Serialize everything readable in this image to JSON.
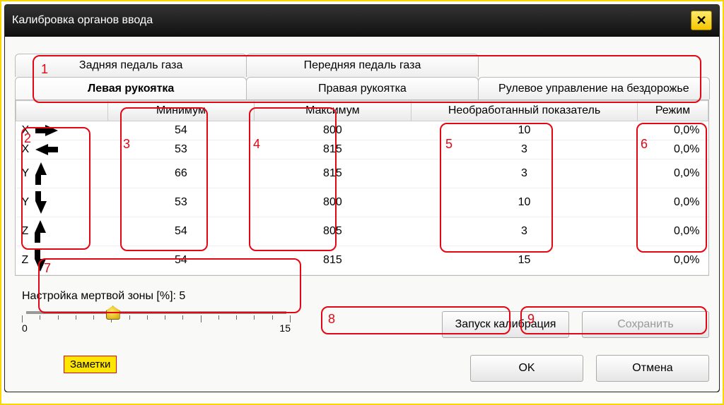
{
  "window": {
    "title": "Калибровка органов ввода"
  },
  "tabs_row1": [
    {
      "label": "Задняя педаль газа"
    },
    {
      "label": "Передняя педаль газа"
    },
    {
      "label": ""
    }
  ],
  "tabs_row2": [
    {
      "label": "Левая рукоятка",
      "active": true
    },
    {
      "label": "Правая рукоятка"
    },
    {
      "label": "Рулевое управление на бездорожье"
    }
  ],
  "columns": {
    "axis": "",
    "min": "Минимум",
    "max": "Максимум",
    "raw": "Необработанный показатель",
    "mode": "Режим"
  },
  "rows": [
    {
      "axis": "X",
      "dir": "right",
      "min": "54",
      "max": "800",
      "raw": "10",
      "mode": "0,0%"
    },
    {
      "axis": "X",
      "dir": "left",
      "min": "53",
      "max": "815",
      "raw": "3",
      "mode": "0,0%"
    },
    {
      "axis": "Y",
      "dir": "up",
      "min": "66",
      "max": "815",
      "raw": "3",
      "mode": "0,0%"
    },
    {
      "axis": "Y",
      "dir": "down",
      "min": "53",
      "max": "800",
      "raw": "10",
      "mode": "0,0%"
    },
    {
      "axis": "Z",
      "dir": "up",
      "min": "54",
      "max": "805",
      "raw": "3",
      "mode": "0,0%"
    },
    {
      "axis": "Z",
      "dir": "down",
      "min": "54",
      "max": "815",
      "raw": "15",
      "mode": "0,0%"
    }
  ],
  "deadzone": {
    "label": "Настройка мертвой зоны [%]: 5",
    "value": 5,
    "min": 0,
    "max": 15,
    "min_label": "0",
    "max_label": "15"
  },
  "buttons": {
    "start": "Запуск калибрация",
    "save": "Сохранить",
    "ok": "OK",
    "cancel": "Отмена"
  },
  "notes_badge": "Заметки",
  "annotations": {
    "1": "1",
    "2": "2",
    "3": "3",
    "4": "4",
    "5": "5",
    "6": "6",
    "7": "7",
    "8": "8",
    "9": "9"
  }
}
